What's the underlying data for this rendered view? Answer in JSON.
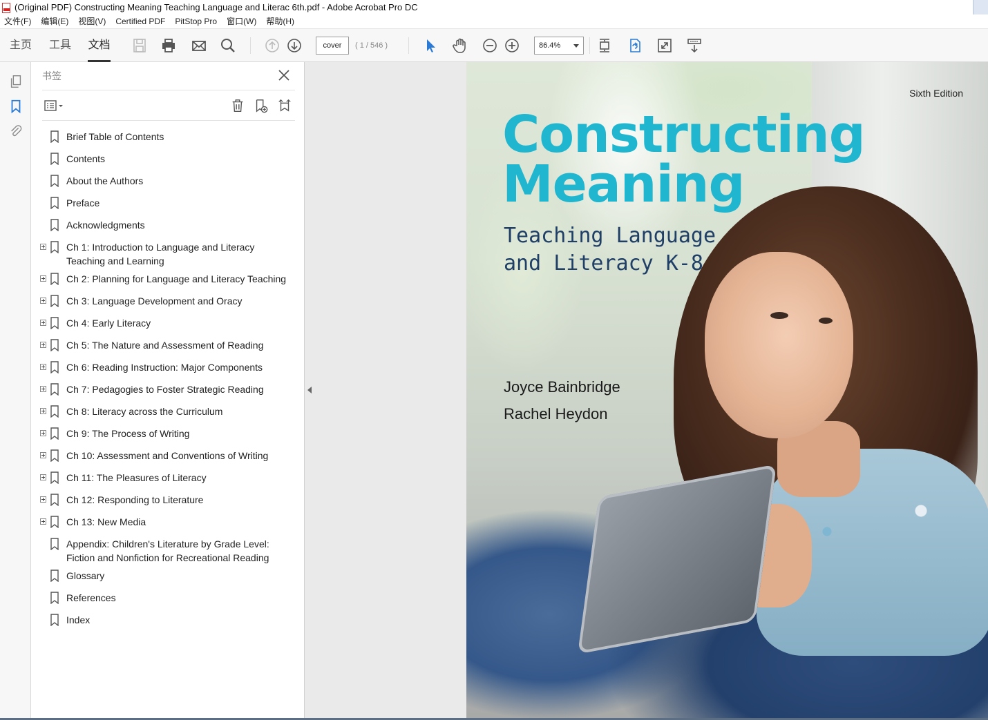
{
  "window": {
    "title": "(Original PDF) Constructing Meaning Teaching Language and Literac 6th.pdf - Adobe Acrobat Pro DC"
  },
  "menubar": {
    "items": [
      "文件(F)",
      "编辑(E)",
      "视图(V)",
      "Certified PDF",
      "PitStop Pro",
      "窗口(W)",
      "帮助(H)"
    ]
  },
  "toolbar": {
    "tabs": [
      "主页",
      "工具",
      "文档"
    ],
    "active_tab": "文档",
    "page_input_value": "cover",
    "page_count": "( 1 / 546 )",
    "zoom_value": "86.4%",
    "icons": [
      "save-icon",
      "print-icon",
      "email-icon",
      "search-icon",
      "page-up-icon",
      "page-down-icon",
      "select-arrow-icon",
      "hand-icon",
      "zoom-out-icon",
      "zoom-in-icon",
      "fit-page-icon",
      "rotate-icon",
      "full-screen-icon",
      "read-mode-icon"
    ]
  },
  "rail": {
    "icons": [
      "pages-icon",
      "bookmark-icon",
      "attachment-icon"
    ]
  },
  "bookmarks_panel": {
    "title": "书签",
    "items": [
      {
        "label": "Brief Table of Contents",
        "expandable": false
      },
      {
        "label": "Contents",
        "expandable": false
      },
      {
        "label": "About the Authors",
        "expandable": false
      },
      {
        "label": "Preface",
        "expandable": false
      },
      {
        "label": "Acknowledgments",
        "expandable": false
      },
      {
        "label": "Ch 1: Introduction to Language and Literacy Teaching and Learning",
        "expandable": true
      },
      {
        "label": "Ch 2: Planning for Language and Literacy Teaching",
        "expandable": true
      },
      {
        "label": "Ch 3: Language Development and Oracy",
        "expandable": true
      },
      {
        "label": "Ch 4: Early Literacy",
        "expandable": true
      },
      {
        "label": "Ch 5: The Nature and Assessment of Reading",
        "expandable": true
      },
      {
        "label": "Ch 6: Reading Instruction: Major Components",
        "expandable": true
      },
      {
        "label": "Ch 7: Pedagogies to Foster Strategic Reading",
        "expandable": true
      },
      {
        "label": "Ch 8: Literacy across the Curriculum",
        "expandable": true
      },
      {
        "label": "Ch 9: The Process of Writing",
        "expandable": true
      },
      {
        "label": "Ch 10: Assessment and Conventions of Writing",
        "expandable": true
      },
      {
        "label": "Ch 11: The Pleasures of Literacy",
        "expandable": true
      },
      {
        "label": "Ch 12: Responding to Literature",
        "expandable": true
      },
      {
        "label": "Ch 13: New Media",
        "expandable": true
      },
      {
        "label": "Appendix: Children's Literature by Grade Level: Fiction and Nonfiction for Recreational Reading",
        "expandable": false
      },
      {
        "label": "Glossary",
        "expandable": false
      },
      {
        "label": "References",
        "expandable": false
      },
      {
        "label": "Index",
        "expandable": false
      }
    ]
  },
  "cover": {
    "edition": "Sixth Edition",
    "title_line1": "Constructing",
    "title_line2": "Meaning",
    "subtitle_line1": "Teaching Language",
    "subtitle_line2": "and Literacy K-8",
    "author1": "Joyce Bainbridge",
    "author2": "Rachel Heydon",
    "title_color": "#21b6cf",
    "subtitle_color": "#1f3f66"
  }
}
